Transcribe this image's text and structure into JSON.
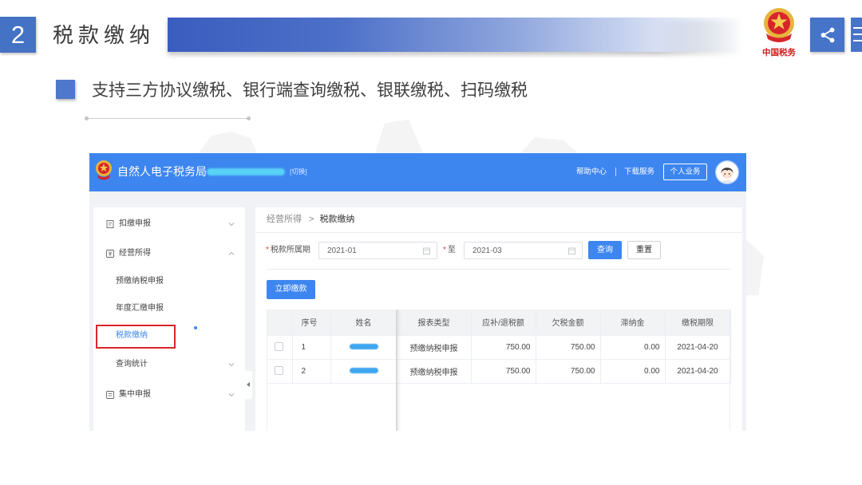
{
  "slide": {
    "section_number": "2",
    "title": "税款缴纳",
    "bullet_text": "支持三方协议缴税、银行端查询缴税、银联缴税、扫码缴税",
    "emblem_caption": "中国税务",
    "icons": {
      "emblem": "tax-emblem-icon",
      "share": "share-icon",
      "menu": "menu-lines-icon"
    },
    "colors": {
      "accent": "#4472c4",
      "title_bar": "#3a5dbf"
    }
  },
  "app": {
    "brand": "自然人电子税务局",
    "switch_label": "[切换]",
    "help_link": "帮助中心",
    "download_link": "下载服务",
    "personal_button": "个人业务",
    "colors": {
      "primary": "#3d86f0",
      "highlight_box": "#d9262a",
      "required_mark": "#e23c3c"
    },
    "sidebar": {
      "items": [
        {
          "label": "扣缴申报",
          "icon": "document-icon",
          "expanded": false
        },
        {
          "label": "经营所得",
          "icon": "income-icon",
          "expanded": true
        },
        {
          "label": "预缴纳税申报"
        },
        {
          "label": "年度汇缴申报"
        },
        {
          "label": "税款缴纳",
          "active": true,
          "highlighted": true
        },
        {
          "label": "查询统计",
          "expanded": false
        },
        {
          "label": "集中申报",
          "icon": "batch-icon",
          "expanded": false
        }
      ]
    },
    "breadcrumb": {
      "parent": "经营所得",
      "separator": ">",
      "current": "税款缴纳"
    },
    "filter": {
      "required_mark": "*",
      "period_label": "税款所属期",
      "start_value": "2021-01",
      "to_label": "至",
      "end_value": "2021-03",
      "query_button": "查询",
      "reset_button": "重置"
    },
    "pay_now_button": "立即缴款",
    "table": {
      "columns": [
        "序号",
        "姓名",
        "报表类型",
        "应补/退税额",
        "欠税金额",
        "滞纳金",
        "缴税期限"
      ],
      "rows": [
        {
          "index": "1",
          "report_type": "预缴纳税申报",
          "payable": "750.00",
          "arrears": "750.00",
          "late_fee": "0.00",
          "deadline": "2021-04-20",
          "selected": false
        },
        {
          "index": "2",
          "report_type": "预缴纳税申报",
          "payable": "750.00",
          "arrears": "750.00",
          "late_fee": "0.00",
          "deadline": "2021-04-20",
          "selected": false
        }
      ]
    }
  }
}
